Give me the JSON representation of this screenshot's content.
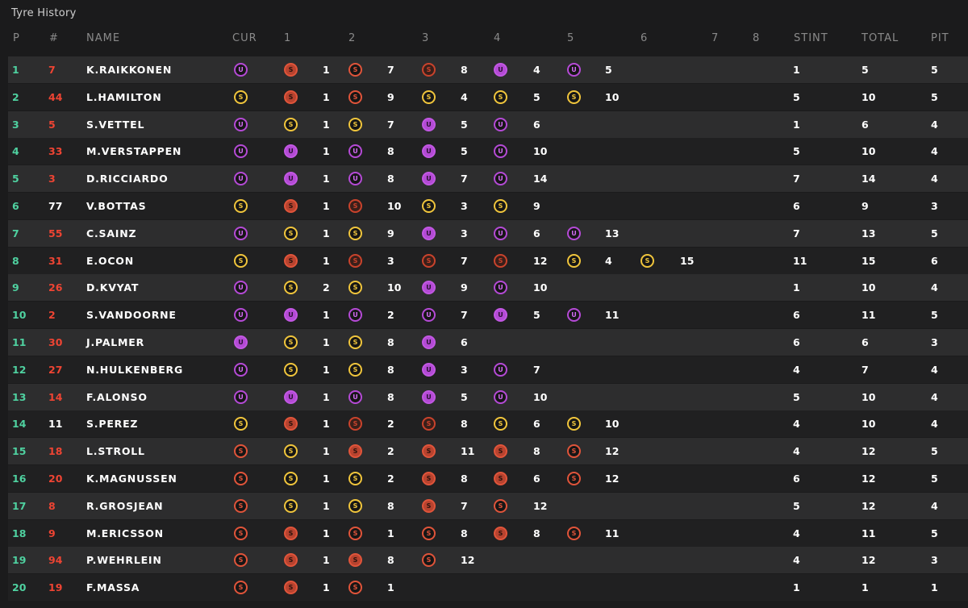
{
  "title": "Tyre History",
  "headers": {
    "p": "P",
    "num": "#",
    "name": "NAME",
    "cur": "CUR",
    "s1": "1",
    "s2": "2",
    "s3": "3",
    "s4": "4",
    "s5": "5",
    "s6": "6",
    "s7": "7",
    "s8": "8",
    "stint": "STINT",
    "total": "TOTAL",
    "pit": "PIT"
  },
  "colors": {
    "position": "#4fd1a0",
    "number_red": "#ee4433",
    "supersoft_red": "#e0543a",
    "soft_yellow": "#f0c53c",
    "ultrasoft_purple": "#b54ad6"
  },
  "tyre_letters": {
    "S": "S",
    "U": "U"
  },
  "rows": [
    {
      "p": "1",
      "num": "7",
      "num_color": "red",
      "name": "K.RAIKKONEN",
      "cur": "U-purple",
      "stints": [
        [
          "S-red-fill",
          "1"
        ],
        [
          "S-red",
          "7"
        ],
        [
          "S-red-dark",
          "8"
        ],
        [
          "U-purple-fill",
          "4"
        ],
        [
          "U-purple",
          "5"
        ]
      ],
      "stint": "1",
      "total": "5",
      "pit": "5"
    },
    {
      "p": "2",
      "num": "44",
      "num_color": "red",
      "name": "L.HAMILTON",
      "cur": "S-yellow",
      "stints": [
        [
          "S-red-fill",
          "1"
        ],
        [
          "S-red",
          "9"
        ],
        [
          "S-yellow",
          "4"
        ],
        [
          "S-yellow",
          "5"
        ],
        [
          "S-yellow",
          "10"
        ]
      ],
      "stint": "5",
      "total": "10",
      "pit": "5"
    },
    {
      "p": "3",
      "num": "5",
      "num_color": "red",
      "name": "S.VETTEL",
      "cur": "U-purple",
      "stints": [
        [
          "S-yellow",
          "1"
        ],
        [
          "S-yellow",
          "7"
        ],
        [
          "U-purple-fill",
          "5"
        ],
        [
          "U-purple",
          "6"
        ]
      ],
      "stint": "1",
      "total": "6",
      "pit": "4"
    },
    {
      "p": "4",
      "num": "33",
      "num_color": "red",
      "name": "M.VERSTAPPEN",
      "cur": "U-purple",
      "stints": [
        [
          "U-purple-fill",
          "1"
        ],
        [
          "U-purple",
          "8"
        ],
        [
          "U-purple-fill",
          "5"
        ],
        [
          "U-purple",
          "10"
        ]
      ],
      "stint": "5",
      "total": "10",
      "pit": "4"
    },
    {
      "p": "5",
      "num": "3",
      "num_color": "red",
      "name": "D.RICCIARDO",
      "cur": "U-purple",
      "stints": [
        [
          "U-purple-fill",
          "1"
        ],
        [
          "U-purple",
          "8"
        ],
        [
          "U-purple-fill",
          "7"
        ],
        [
          "U-purple",
          "14"
        ]
      ],
      "stint": "7",
      "total": "14",
      "pit": "4"
    },
    {
      "p": "6",
      "num": "77",
      "num_color": "white",
      "name": "V.BOTTAS",
      "cur": "S-yellow",
      "stints": [
        [
          "S-red-fill",
          "1"
        ],
        [
          "S-red-dark",
          "10"
        ],
        [
          "S-yellow",
          "3"
        ],
        [
          "S-yellow",
          "9"
        ]
      ],
      "stint": "6",
      "total": "9",
      "pit": "3"
    },
    {
      "p": "7",
      "num": "55",
      "num_color": "red",
      "name": "C.SAINZ",
      "cur": "U-purple",
      "stints": [
        [
          "S-yellow",
          "1"
        ],
        [
          "S-yellow",
          "9"
        ],
        [
          "U-purple-fill",
          "3"
        ],
        [
          "U-purple",
          "6"
        ],
        [
          "U-purple",
          "13"
        ]
      ],
      "stint": "7",
      "total": "13",
      "pit": "5"
    },
    {
      "p": "8",
      "num": "31",
      "num_color": "red",
      "name": "E.OCON",
      "cur": "S-yellow",
      "stints": [
        [
          "S-red-fill",
          "1"
        ],
        [
          "S-red-dark",
          "3"
        ],
        [
          "S-red-dark",
          "7"
        ],
        [
          "S-red-dark",
          "12"
        ],
        [
          "S-yellow",
          "4"
        ],
        [
          "S-yellow",
          "15"
        ]
      ],
      "stint": "11",
      "total": "15",
      "pit": "6"
    },
    {
      "p": "9",
      "num": "26",
      "num_color": "red",
      "name": "D.KVYAT",
      "cur": "U-purple",
      "stints": [
        [
          "S-yellow",
          "2"
        ],
        [
          "S-yellow",
          "10"
        ],
        [
          "U-purple-fill",
          "9"
        ],
        [
          "U-purple",
          "10"
        ]
      ],
      "stint": "1",
      "total": "10",
      "pit": "4"
    },
    {
      "p": "10",
      "num": "2",
      "num_color": "red",
      "name": "S.VANDOORNE",
      "cur": "U-purple",
      "stints": [
        [
          "U-purple-fill",
          "1"
        ],
        [
          "U-purple",
          "2"
        ],
        [
          "U-purple",
          "7"
        ],
        [
          "U-purple-fill",
          "5"
        ],
        [
          "U-purple",
          "11"
        ]
      ],
      "stint": "6",
      "total": "11",
      "pit": "5"
    },
    {
      "p": "11",
      "num": "30",
      "num_color": "red",
      "name": "J.PALMER",
      "cur": "U-purple-fill",
      "stints": [
        [
          "S-yellow",
          "1"
        ],
        [
          "S-yellow",
          "8"
        ],
        [
          "U-purple-fill",
          "6"
        ]
      ],
      "stint": "6",
      "total": "6",
      "pit": "3"
    },
    {
      "p": "12",
      "num": "27",
      "num_color": "red",
      "name": "N.HULKENBERG",
      "cur": "U-purple",
      "stints": [
        [
          "S-yellow",
          "1"
        ],
        [
          "S-yellow",
          "8"
        ],
        [
          "U-purple-fill",
          "3"
        ],
        [
          "U-purple",
          "7"
        ]
      ],
      "stint": "4",
      "total": "7",
      "pit": "4"
    },
    {
      "p": "13",
      "num": "14",
      "num_color": "red",
      "name": "F.ALONSO",
      "cur": "U-purple",
      "stints": [
        [
          "U-purple-fill",
          "1"
        ],
        [
          "U-purple",
          "8"
        ],
        [
          "U-purple-fill",
          "5"
        ],
        [
          "U-purple",
          "10"
        ]
      ],
      "stint": "5",
      "total": "10",
      "pit": "4"
    },
    {
      "p": "14",
      "num": "11",
      "num_color": "white",
      "name": "S.PEREZ",
      "cur": "S-yellow",
      "stints": [
        [
          "S-red-fill",
          "1"
        ],
        [
          "S-red-dark",
          "2"
        ],
        [
          "S-red-dark",
          "8"
        ],
        [
          "S-yellow",
          "6"
        ],
        [
          "S-yellow",
          "10"
        ]
      ],
      "stint": "4",
      "total": "10",
      "pit": "4"
    },
    {
      "p": "15",
      "num": "18",
      "num_color": "red",
      "name": "L.STROLL",
      "cur": "S-red",
      "stints": [
        [
          "S-yellow",
          "1"
        ],
        [
          "S-red-fill",
          "2"
        ],
        [
          "S-red-fill",
          "11"
        ],
        [
          "S-red-fill",
          "8"
        ],
        [
          "S-red",
          "12"
        ]
      ],
      "stint": "4",
      "total": "12",
      "pit": "5"
    },
    {
      "p": "16",
      "num": "20",
      "num_color": "red",
      "name": "K.MAGNUSSEN",
      "cur": "S-red",
      "stints": [
        [
          "S-yellow",
          "1"
        ],
        [
          "S-yellow",
          "2"
        ],
        [
          "S-red-fill",
          "8"
        ],
        [
          "S-red-fill",
          "6"
        ],
        [
          "S-red",
          "12"
        ]
      ],
      "stint": "6",
      "total": "12",
      "pit": "5"
    },
    {
      "p": "17",
      "num": "8",
      "num_color": "red",
      "name": "R.GROSJEAN",
      "cur": "S-red",
      "stints": [
        [
          "S-yellow",
          "1"
        ],
        [
          "S-yellow",
          "8"
        ],
        [
          "S-red-fill",
          "7"
        ],
        [
          "S-red",
          "12"
        ]
      ],
      "stint": "5",
      "total": "12",
      "pit": "4"
    },
    {
      "p": "18",
      "num": "9",
      "num_color": "red",
      "name": "M.ERICSSON",
      "cur": "S-red",
      "stints": [
        [
          "S-red-fill",
          "1"
        ],
        [
          "S-red",
          "1"
        ],
        [
          "S-red",
          "8"
        ],
        [
          "S-red-fill",
          "8"
        ],
        [
          "S-red",
          "11"
        ]
      ],
      "stint": "4",
      "total": "11",
      "pit": "5"
    },
    {
      "p": "19",
      "num": "94",
      "num_color": "red",
      "name": "P.WEHRLEIN",
      "cur": "S-red",
      "stints": [
        [
          "S-red-fill",
          "1"
        ],
        [
          "S-red-fill",
          "8"
        ],
        [
          "S-red",
          "12"
        ]
      ],
      "stint": "4",
      "total": "12",
      "pit": "3"
    },
    {
      "p": "20",
      "num": "19",
      "num_color": "red",
      "name": "F.MASSA",
      "cur": "S-red",
      "stints": [
        [
          "S-red-fill",
          "1"
        ],
        [
          "S-red",
          "1"
        ]
      ],
      "stint": "1",
      "total": "1",
      "pit": "1"
    }
  ]
}
